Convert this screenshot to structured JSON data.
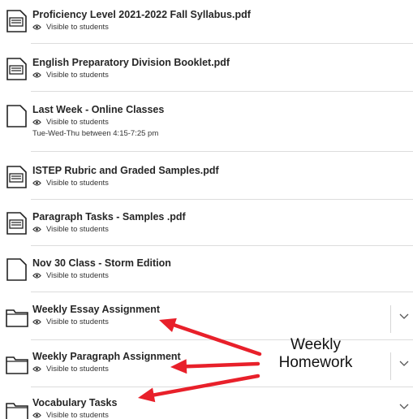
{
  "items": [
    {
      "title": "Proficiency Level 2021-2022 Fall Syllabus.pdf",
      "visibility": "Visible to students",
      "icon": "document-icon",
      "note": ""
    },
    {
      "title": "English Preparatory Division Booklet.pdf",
      "visibility": "Visible to students",
      "icon": "document-icon",
      "note": ""
    },
    {
      "title": "Last Week - Online Classes",
      "visibility": "Visible to students",
      "icon": "page-icon",
      "note": "Tue-Wed-Thu between 4:15-7:25 pm"
    },
    {
      "title": "ISTEP Rubric and Graded Samples.pdf",
      "visibility": "Visible to students",
      "icon": "document-icon",
      "note": ""
    },
    {
      "title": "Paragraph Tasks - Samples .pdf",
      "visibility": "Visible to students",
      "icon": "document-icon",
      "note": ""
    },
    {
      "title": "Nov 30 Class - Storm Edition",
      "visibility": "Visible to students",
      "icon": "page-icon",
      "note": ""
    },
    {
      "title": "Weekly Essay Assignment",
      "visibility": "Visible to students",
      "icon": "folder-icon",
      "note": ""
    },
    {
      "title": "Weekly Paragraph Assignment",
      "visibility": "Visible to students",
      "icon": "folder-icon",
      "note": ""
    },
    {
      "title": "Vocabulary Tasks",
      "visibility": "Visible to students",
      "icon": "folder-icon",
      "note": ""
    }
  ],
  "annotation": {
    "line1": "Weekly",
    "line2": "Homework",
    "arrow_color": "#e8202a"
  }
}
